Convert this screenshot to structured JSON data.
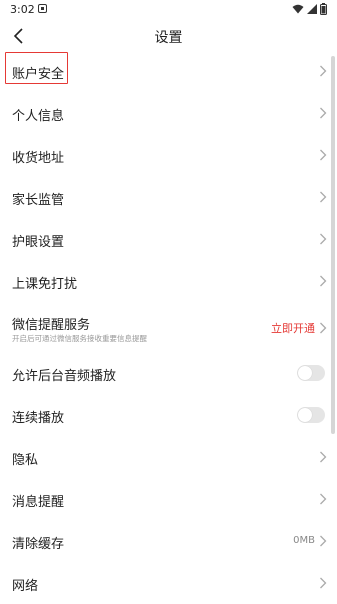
{
  "status_bar": {
    "time": "3:02",
    "icons": [
      "notification-icon",
      "wifi-icon",
      "signal-icon",
      "battery-icon"
    ]
  },
  "header": {
    "title": "设置",
    "back_icon": "back-arrow-icon"
  },
  "settings": {
    "account_security": "账户安全",
    "personal_info": "个人信息",
    "shipping_address": "收货地址",
    "parental_control": "家长监管",
    "eye_protection": "护眼设置",
    "class_dnd": "上课免打扰",
    "wechat_reminder": {
      "label": "微信提醒服务",
      "subtitle": "开启后可通过微信服务接收重要信息提醒",
      "action": "立即开通"
    },
    "background_audio": "允许后台音频播放",
    "continuous_play": "连续播放",
    "privacy": "隐私",
    "message_reminder": "消息提醒",
    "clear_cache": {
      "label": "清除缓存",
      "value": "0MB"
    },
    "network": "网络"
  },
  "toggles": {
    "background_audio_on": false,
    "continuous_play_on": false
  },
  "colors": {
    "accent_red": "#e53935",
    "toggle_off": "#e5e5e5"
  }
}
